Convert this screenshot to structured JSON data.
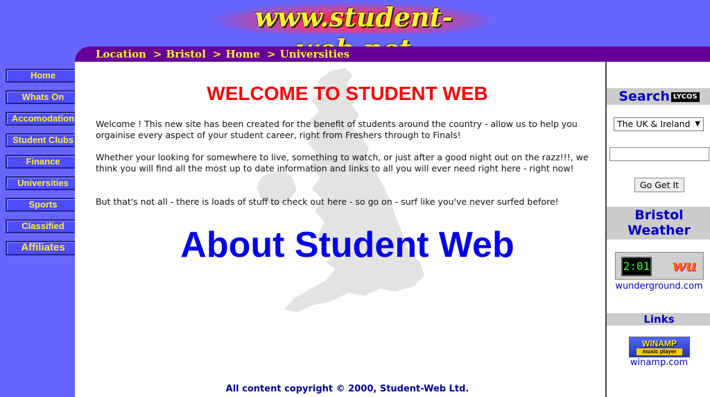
{
  "header": {
    "logo": "www.student-web.net"
  },
  "breadcrumb": {
    "items": [
      "Location",
      "Bristol",
      "Home",
      "Universities"
    ],
    "separator": ">"
  },
  "nav": {
    "items": [
      {
        "label": "Home"
      },
      {
        "label": "Whats On"
      },
      {
        "label": "Accomodation"
      },
      {
        "label": "Student Clubs"
      },
      {
        "label": "Finance"
      },
      {
        "label": "Universities"
      },
      {
        "label": "Sports"
      },
      {
        "label": "Classified"
      },
      {
        "label": "Affiliates"
      }
    ]
  },
  "main": {
    "title": "WELCOME TO STUDENT WEB",
    "para1": "Welcome ! This new site has been created for the benefit of students around the country - allow us to help you orgainise every aspect of your student career, right from Freshers through to Finals!",
    "para2": "Whether your looking for somewhere to live, something to watch, or just after a good night out on the razz!!!, we think you will find all the most up to date information and links to all you will ever need right here - right now!",
    "para3": "But that's not all - there is loads of stuff to check out here - so go on - surf like you've never surfed before!",
    "about": "About Student Web",
    "copyright": "All content copyright © 2000, Student-Web Ltd."
  },
  "sidebar": {
    "search_title": "Search",
    "search_brand": "LYCOS",
    "region_select": "The UK & Ireland",
    "search_value": "",
    "go_button": "Go Get It",
    "weather_title_line1": "Bristol",
    "weather_title_line2": "Weather",
    "weather_time": "2:01",
    "weather_logo": "wu",
    "weather_link": "wunderground.com",
    "links_title": "Links",
    "winamp_title": "WINAMP",
    "winamp_sub": "music player",
    "winamp_link": "winamp.com"
  },
  "colors": {
    "background": "#6666ff",
    "breadcrumb_bar": "#660099",
    "accent_yellow": "#ffee33",
    "title_red": "#ff0000",
    "about_blue": "#0000ee",
    "link_blue": "#0000cc"
  },
  "icons": [
    "uk-map-watermark",
    "chevron-down-icon"
  ]
}
